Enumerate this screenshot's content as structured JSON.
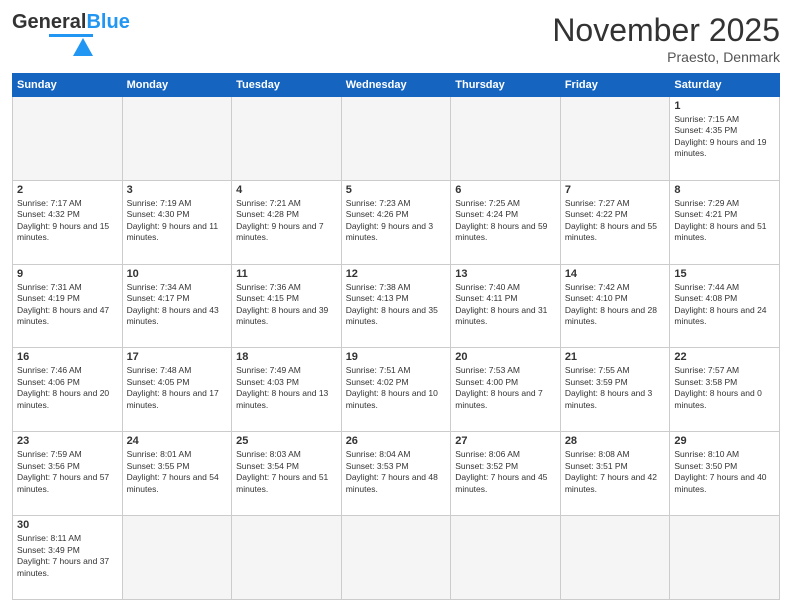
{
  "header": {
    "logo_general": "General",
    "logo_blue": "Blue",
    "month": "November 2025",
    "location": "Praesto, Denmark"
  },
  "weekdays": [
    "Sunday",
    "Monday",
    "Tuesday",
    "Wednesday",
    "Thursday",
    "Friday",
    "Saturday"
  ],
  "days": {
    "1": {
      "sunrise": "7:15 AM",
      "sunset": "4:35 PM",
      "daylight": "9 hours and 19 minutes."
    },
    "2": {
      "sunrise": "7:17 AM",
      "sunset": "4:32 PM",
      "daylight": "9 hours and 15 minutes."
    },
    "3": {
      "sunrise": "7:19 AM",
      "sunset": "4:30 PM",
      "daylight": "9 hours and 11 minutes."
    },
    "4": {
      "sunrise": "7:21 AM",
      "sunset": "4:28 PM",
      "daylight": "9 hours and 7 minutes."
    },
    "5": {
      "sunrise": "7:23 AM",
      "sunset": "4:26 PM",
      "daylight": "9 hours and 3 minutes."
    },
    "6": {
      "sunrise": "7:25 AM",
      "sunset": "4:24 PM",
      "daylight": "8 hours and 59 minutes."
    },
    "7": {
      "sunrise": "7:27 AM",
      "sunset": "4:22 PM",
      "daylight": "8 hours and 55 minutes."
    },
    "8": {
      "sunrise": "7:29 AM",
      "sunset": "4:21 PM",
      "daylight": "8 hours and 51 minutes."
    },
    "9": {
      "sunrise": "7:31 AM",
      "sunset": "4:19 PM",
      "daylight": "8 hours and 47 minutes."
    },
    "10": {
      "sunrise": "7:34 AM",
      "sunset": "4:17 PM",
      "daylight": "8 hours and 43 minutes."
    },
    "11": {
      "sunrise": "7:36 AM",
      "sunset": "4:15 PM",
      "daylight": "8 hours and 39 minutes."
    },
    "12": {
      "sunrise": "7:38 AM",
      "sunset": "4:13 PM",
      "daylight": "8 hours and 35 minutes."
    },
    "13": {
      "sunrise": "7:40 AM",
      "sunset": "4:11 PM",
      "daylight": "8 hours and 31 minutes."
    },
    "14": {
      "sunrise": "7:42 AM",
      "sunset": "4:10 PM",
      "daylight": "8 hours and 28 minutes."
    },
    "15": {
      "sunrise": "7:44 AM",
      "sunset": "4:08 PM",
      "daylight": "8 hours and 24 minutes."
    },
    "16": {
      "sunrise": "7:46 AM",
      "sunset": "4:06 PM",
      "daylight": "8 hours and 20 minutes."
    },
    "17": {
      "sunrise": "7:48 AM",
      "sunset": "4:05 PM",
      "daylight": "8 hours and 17 minutes."
    },
    "18": {
      "sunrise": "7:49 AM",
      "sunset": "4:03 PM",
      "daylight": "8 hours and 13 minutes."
    },
    "19": {
      "sunrise": "7:51 AM",
      "sunset": "4:02 PM",
      "daylight": "8 hours and 10 minutes."
    },
    "20": {
      "sunrise": "7:53 AM",
      "sunset": "4:00 PM",
      "daylight": "8 hours and 7 minutes."
    },
    "21": {
      "sunrise": "7:55 AM",
      "sunset": "3:59 PM",
      "daylight": "8 hours and 3 minutes."
    },
    "22": {
      "sunrise": "7:57 AM",
      "sunset": "3:58 PM",
      "daylight": "8 hours and 0 minutes."
    },
    "23": {
      "sunrise": "7:59 AM",
      "sunset": "3:56 PM",
      "daylight": "7 hours and 57 minutes."
    },
    "24": {
      "sunrise": "8:01 AM",
      "sunset": "3:55 PM",
      "daylight": "7 hours and 54 minutes."
    },
    "25": {
      "sunrise": "8:03 AM",
      "sunset": "3:54 PM",
      "daylight": "7 hours and 51 minutes."
    },
    "26": {
      "sunrise": "8:04 AM",
      "sunset": "3:53 PM",
      "daylight": "7 hours and 48 minutes."
    },
    "27": {
      "sunrise": "8:06 AM",
      "sunset": "3:52 PM",
      "daylight": "7 hours and 45 minutes."
    },
    "28": {
      "sunrise": "8:08 AM",
      "sunset": "3:51 PM",
      "daylight": "7 hours and 42 minutes."
    },
    "29": {
      "sunrise": "8:10 AM",
      "sunset": "3:50 PM",
      "daylight": "7 hours and 40 minutes."
    },
    "30": {
      "sunrise": "8:11 AM",
      "sunset": "3:49 PM",
      "daylight": "7 hours and 37 minutes."
    }
  }
}
